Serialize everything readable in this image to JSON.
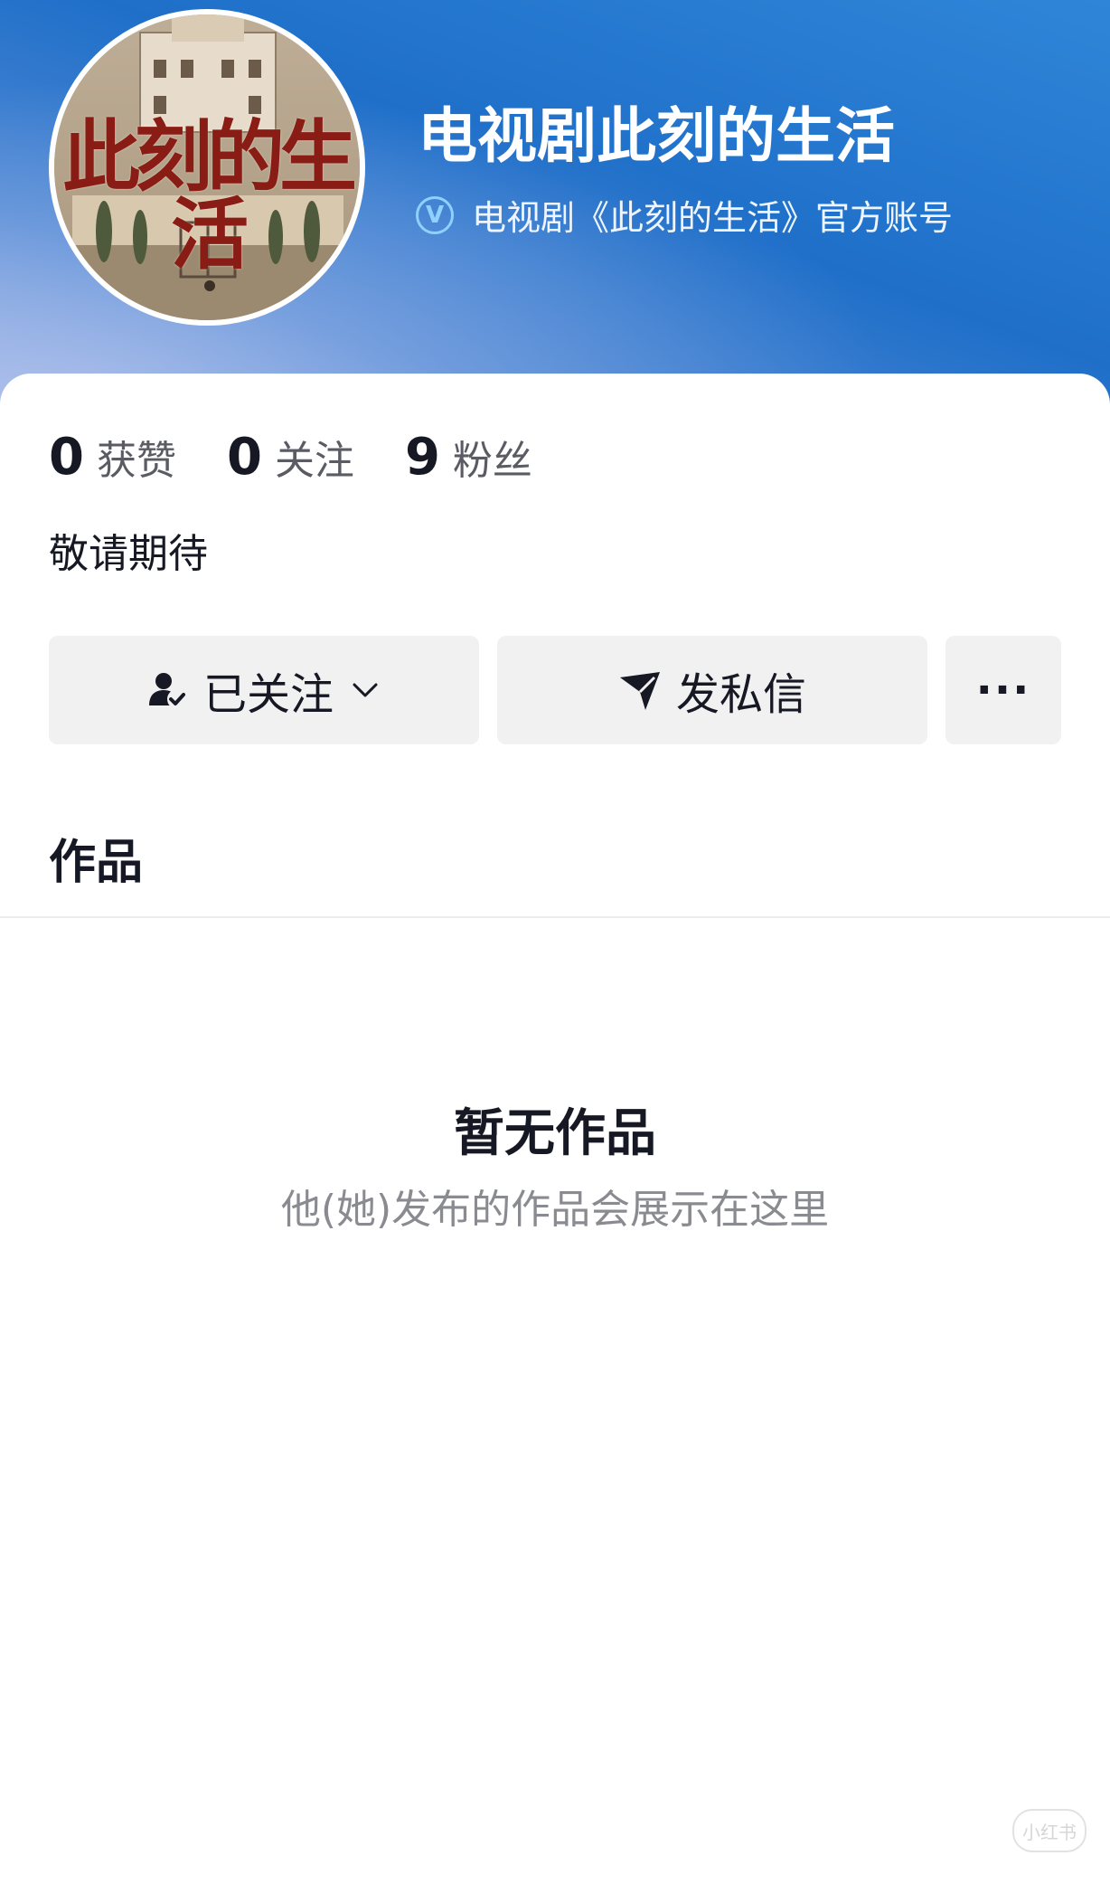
{
  "profile": {
    "avatar_text": "此刻的生活",
    "nickname": "电视剧此刻的生活",
    "verify_badge": "V",
    "verify_text": "电视剧《此刻的生活》官方账号"
  },
  "stats": [
    {
      "num": "0",
      "label": "获赞"
    },
    {
      "num": "0",
      "label": "关注"
    },
    {
      "num": "9",
      "label": "粉丝"
    }
  ],
  "bio": "敬请期待",
  "buttons": {
    "follow_label": "已关注",
    "message_label": "发私信",
    "more_label": "···"
  },
  "works": {
    "section_title": "作品",
    "empty_title": "暂无作品",
    "empty_sub": "他(她)发布的作品会展示在这里"
  },
  "watermark": "小红书",
  "colors": {
    "header_blue": "#1f6fc9",
    "button_bg": "#f1f1f2",
    "verify_badge": "#8fd0ff"
  },
  "icons": {
    "verify": "verified-badge-icon",
    "follow": "user-check-icon",
    "chevron": "chevron-down-icon",
    "message": "paper-plane-icon",
    "more": "more-icon"
  }
}
